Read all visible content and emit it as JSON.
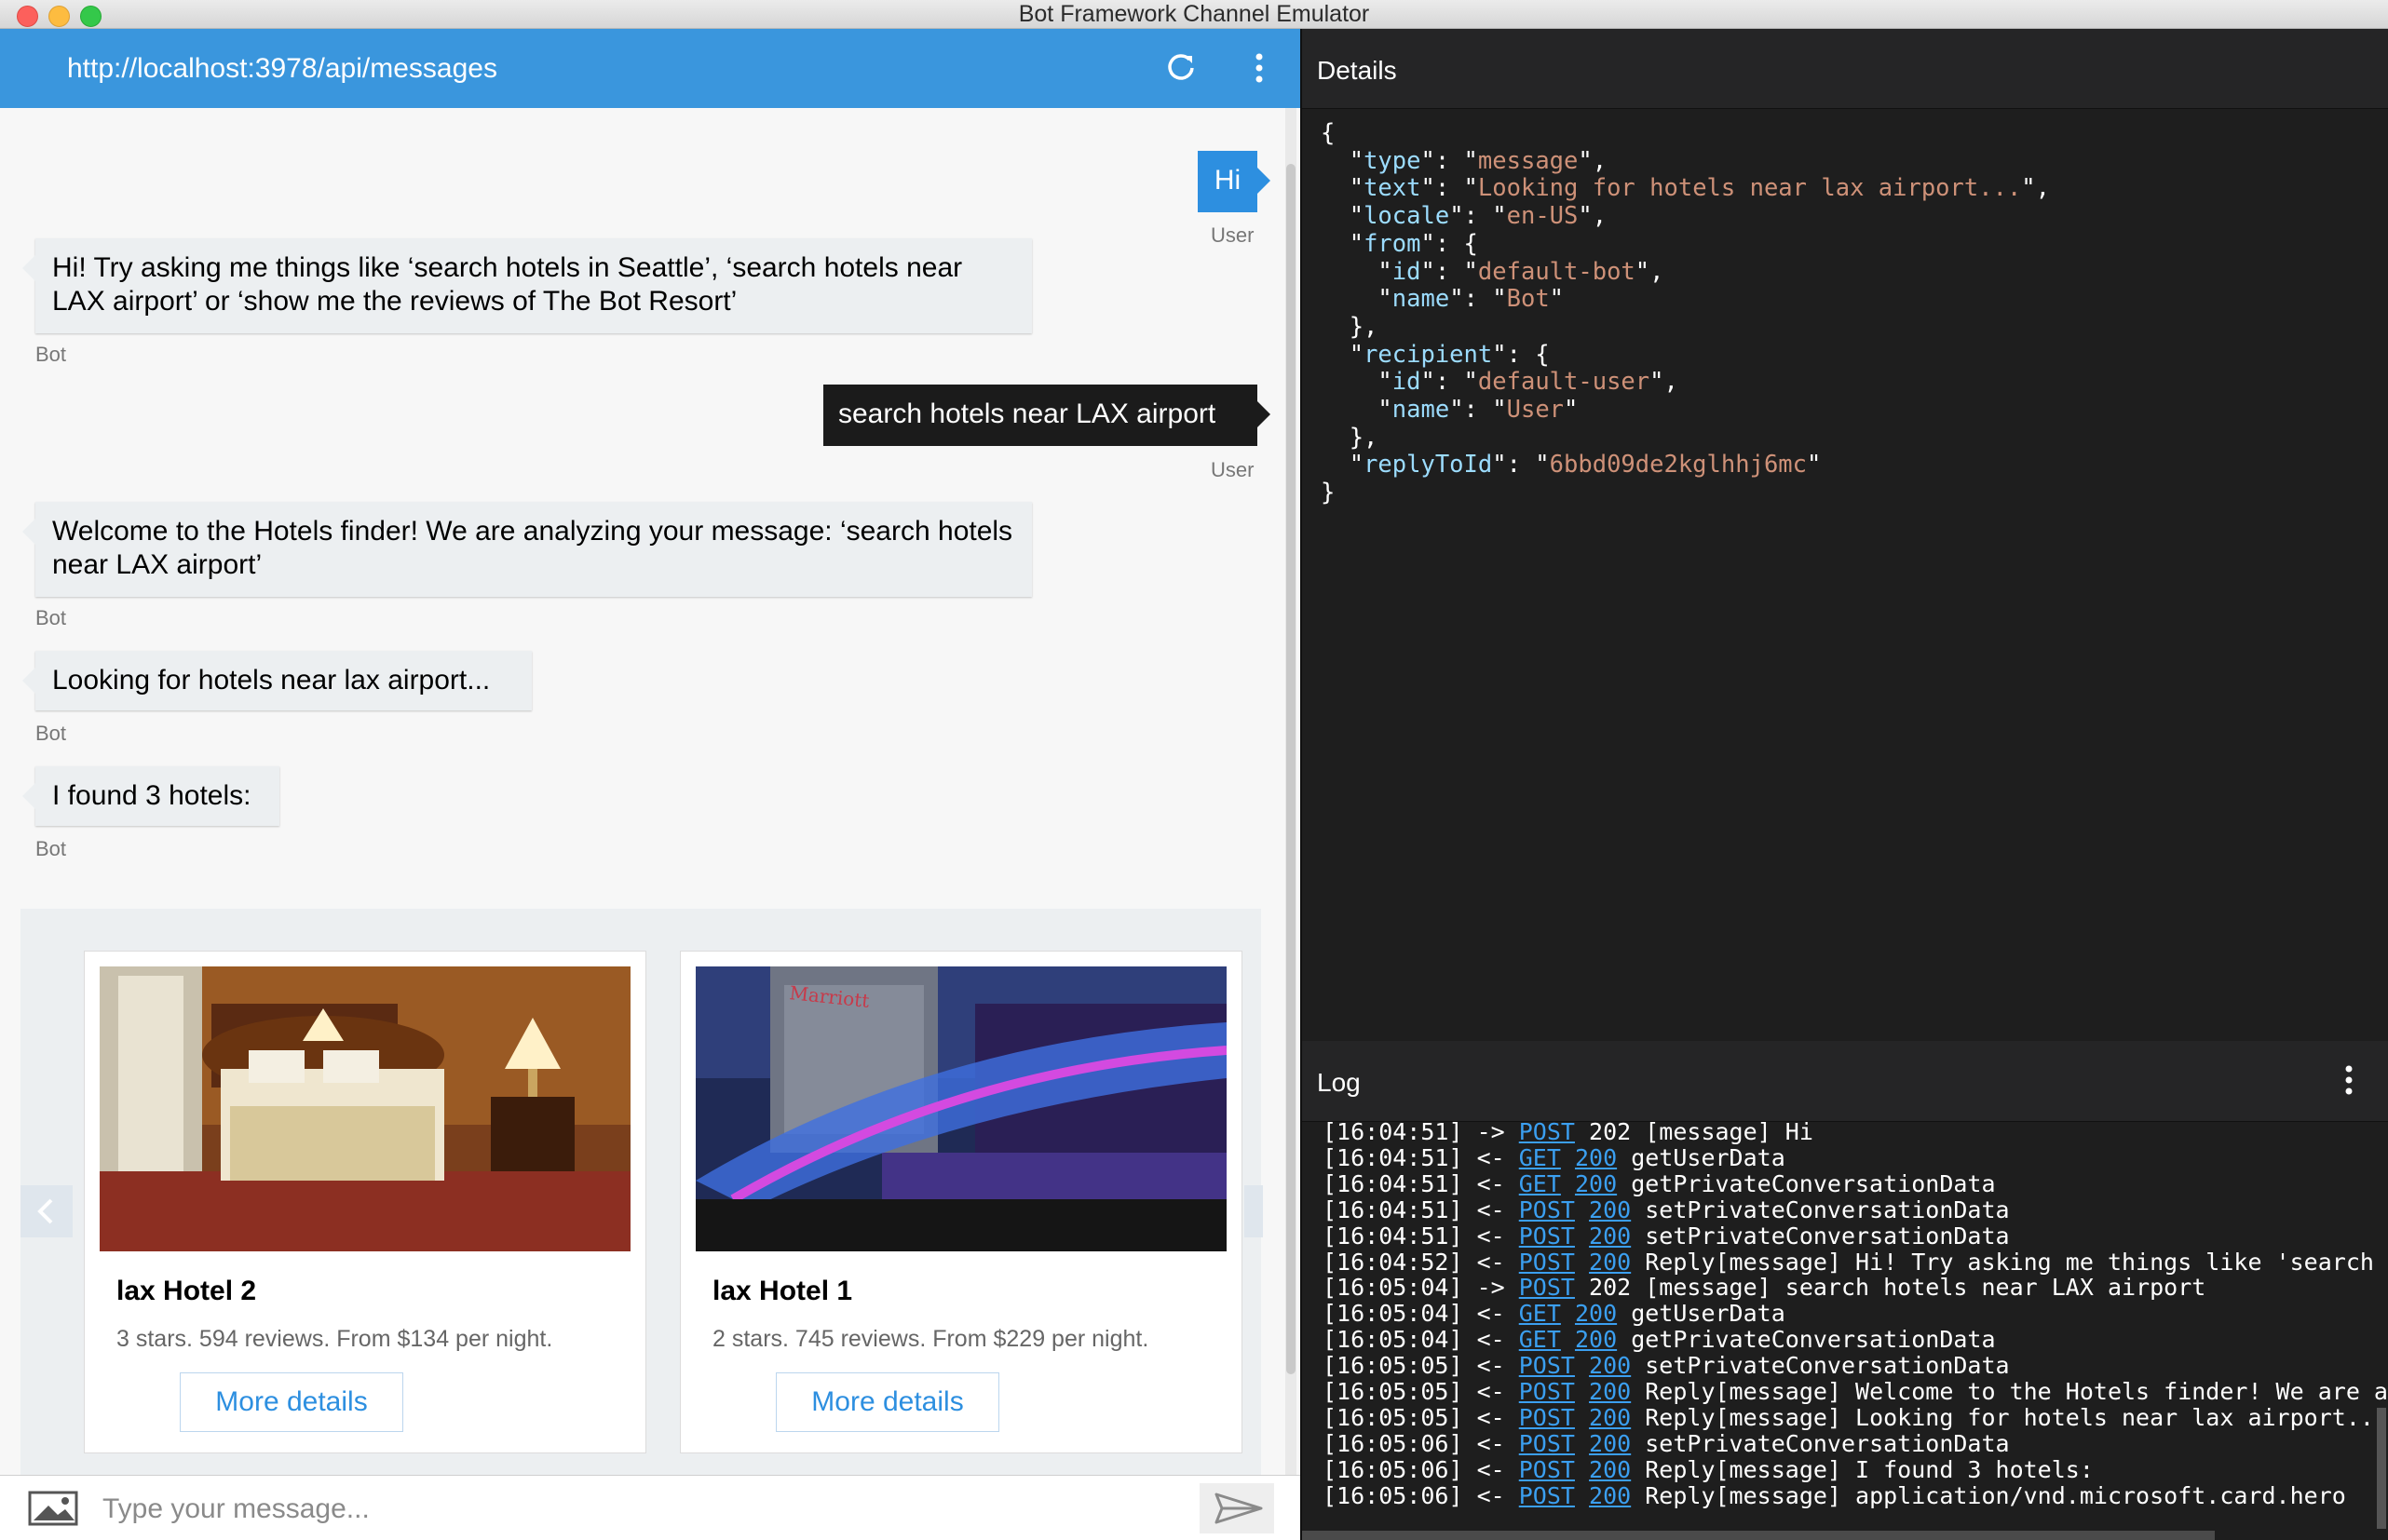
{
  "window": {
    "title": "Bot Framework Channel Emulator"
  },
  "chat": {
    "url": "http://localhost:3978/api/messages",
    "messages": [
      {
        "from": "user",
        "text": "Hi",
        "label": "User"
      },
      {
        "from": "bot",
        "text": "Hi! Try asking me things like ‘search hotels in Seattle’, ‘search hotels near LAX airport’ or ‘show me the reviews of The Bot Resort’",
        "label": "Bot"
      },
      {
        "from": "user",
        "text": "search hotels near LAX airport",
        "label": "User"
      },
      {
        "from": "bot",
        "text": "Welcome to the Hotels finder! We are analyzing your message: ‘search hotels near LAX airport’",
        "label": "Bot"
      },
      {
        "from": "bot",
        "text": "Looking for hotels near lax airport...",
        "label": "Bot"
      },
      {
        "from": "bot",
        "text": "I found 3 hotels:",
        "label": "Bot"
      }
    ],
    "cards": [
      {
        "title": "lax Hotel 2",
        "subtitle": "3 stars. 594 reviews. From $134 per night.",
        "button": "More details"
      },
      {
        "title": "lax Hotel 1",
        "subtitle": "2 stars. 745 reviews. From $229 per night.",
        "button": "More details"
      }
    ],
    "input_placeholder": "Type your message..."
  },
  "details": {
    "title": "Details",
    "json": {
      "type": "message",
      "text": "Looking for hotels near lax airport...",
      "locale": "en-US",
      "from_id": "default-bot",
      "from_name": "Bot",
      "recipient_id": "default-user",
      "recipient_name": "User",
      "replyToId": "6bbd09de2kglhhj6mc"
    }
  },
  "log": {
    "title": "Log",
    "lines": [
      {
        "time": "[16:04:51]",
        "dir": "->",
        "method": "POST",
        "status": "202",
        "msg": "[message] Hi"
      },
      {
        "time": "[16:04:51]",
        "dir": "<-",
        "method": "GET",
        "status": "200",
        "msg": "getUserData"
      },
      {
        "time": "[16:04:51]",
        "dir": "<-",
        "method": "GET",
        "status": "200",
        "msg": "getPrivateConversationData"
      },
      {
        "time": "[16:04:51]",
        "dir": "<-",
        "method": "POST",
        "status": "200",
        "msg": "setPrivateConversationData"
      },
      {
        "time": "[16:04:51]",
        "dir": "<-",
        "method": "POST",
        "status": "200",
        "msg": "setPrivateConversationData"
      },
      {
        "time": "[16:04:52]",
        "dir": "<-",
        "method": "POST",
        "status": "200",
        "msg": "Reply[message] Hi! Try asking me things like 'search ho"
      },
      {
        "time": "[16:05:04]",
        "dir": "->",
        "method": "POST",
        "status": "202",
        "msg": "[message] search hotels near LAX airport"
      },
      {
        "time": "[16:05:04]",
        "dir": "<-",
        "method": "GET",
        "status": "200",
        "msg": "getUserData"
      },
      {
        "time": "[16:05:04]",
        "dir": "<-",
        "method": "GET",
        "status": "200",
        "msg": "getPrivateConversationData"
      },
      {
        "time": "[16:05:05]",
        "dir": "<-",
        "method": "POST",
        "status": "200",
        "msg": "setPrivateConversationData"
      },
      {
        "time": "[16:05:05]",
        "dir": "<-",
        "method": "POST",
        "status": "200",
        "msg": "Reply[message] Welcome to the Hotels finder! We are ana"
      },
      {
        "time": "[16:05:05]",
        "dir": "<-",
        "method": "POST",
        "status": "200",
        "msg": "Reply[message] Looking for hotels near lax airport..."
      },
      {
        "time": "[16:05:06]",
        "dir": "<-",
        "method": "POST",
        "status": "200",
        "msg": "setPrivateConversationData"
      },
      {
        "time": "[16:05:06]",
        "dir": "<-",
        "method": "POST",
        "status": "200",
        "msg": "Reply[message] I found 3 hotels:"
      },
      {
        "time": "[16:05:06]",
        "dir": "<-",
        "method": "POST",
        "status": "200",
        "msg": "Reply[message] application/vnd.microsoft.card.hero"
      }
    ]
  }
}
